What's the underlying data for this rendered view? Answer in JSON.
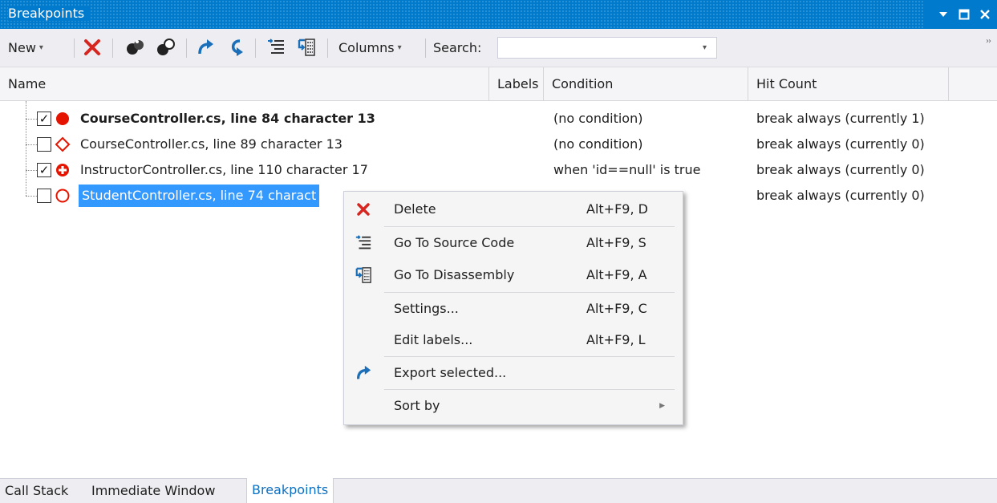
{
  "window": {
    "title": "Breakpoints",
    "controls": [
      "dropdown-arrow",
      "maximize",
      "close"
    ]
  },
  "toolbar": {
    "new_label": "New",
    "columns_label": "Columns",
    "search_label": "Search:",
    "search_value": "",
    "icons": [
      "delete-icon",
      "enable-disable-icon",
      "disable-all-icon",
      "export-icon",
      "import-icon",
      "go-to-source-icon",
      "go-to-disassembly-icon"
    ]
  },
  "columns": {
    "name": "Name",
    "labels": "Labels",
    "condition": "Condition",
    "hit_count": "Hit Count"
  },
  "rows": [
    {
      "checked": true,
      "icon": "breakpoint-filled-red",
      "name": "CourseController.cs, line 84 character 13",
      "bold": true,
      "condition": "(no condition)",
      "hit_count": "break always (currently 1)"
    },
    {
      "checked": false,
      "icon": "breakpoint-diamond-outline",
      "name": "CourseController.cs, line 89 character 13",
      "bold": false,
      "condition": "(no condition)",
      "hit_count": "break always (currently 0)"
    },
    {
      "checked": true,
      "icon": "breakpoint-conditional-plus",
      "name": "InstructorController.cs, line 110 character 17",
      "bold": false,
      "condition": "when 'id==null' is true",
      "hit_count": "break always (currently 0)"
    },
    {
      "checked": false,
      "icon": "breakpoint-circle-outline",
      "name": "StudentController.cs, line 74 charact",
      "bold": false,
      "selected": true,
      "condition": "",
      "hit_count": "break always (currently 0)"
    }
  ],
  "context_menu": {
    "items": [
      {
        "label": "Delete",
        "shortcut": "Alt+F9, D",
        "icon": "delete-icon"
      },
      {
        "label": "Go To Source Code",
        "shortcut": "Alt+F9, S",
        "icon": "go-to-source-icon"
      },
      {
        "label": "Go To Disassembly",
        "shortcut": "Alt+F9, A",
        "icon": "go-to-disassembly-icon"
      },
      {
        "label": "Settings...",
        "shortcut": "Alt+F9, C",
        "icon": ""
      },
      {
        "label": "Edit labels...",
        "shortcut": "Alt+F9, L",
        "icon": ""
      },
      {
        "label": "Export selected...",
        "shortcut": "",
        "icon": "export-icon"
      },
      {
        "label": "Sort by",
        "shortcut": "",
        "icon": "",
        "submenu": true
      }
    ]
  },
  "tabs": [
    {
      "label": "Call Stack",
      "active": false
    },
    {
      "label": "Immediate Window",
      "active": false
    },
    {
      "label": "Breakpoints",
      "active": true
    }
  ],
  "colors": {
    "accent": "#007acc",
    "selection": "#3399ff",
    "breakpoint_red": "#e51400",
    "active_tab_text": "#0e70c0"
  }
}
